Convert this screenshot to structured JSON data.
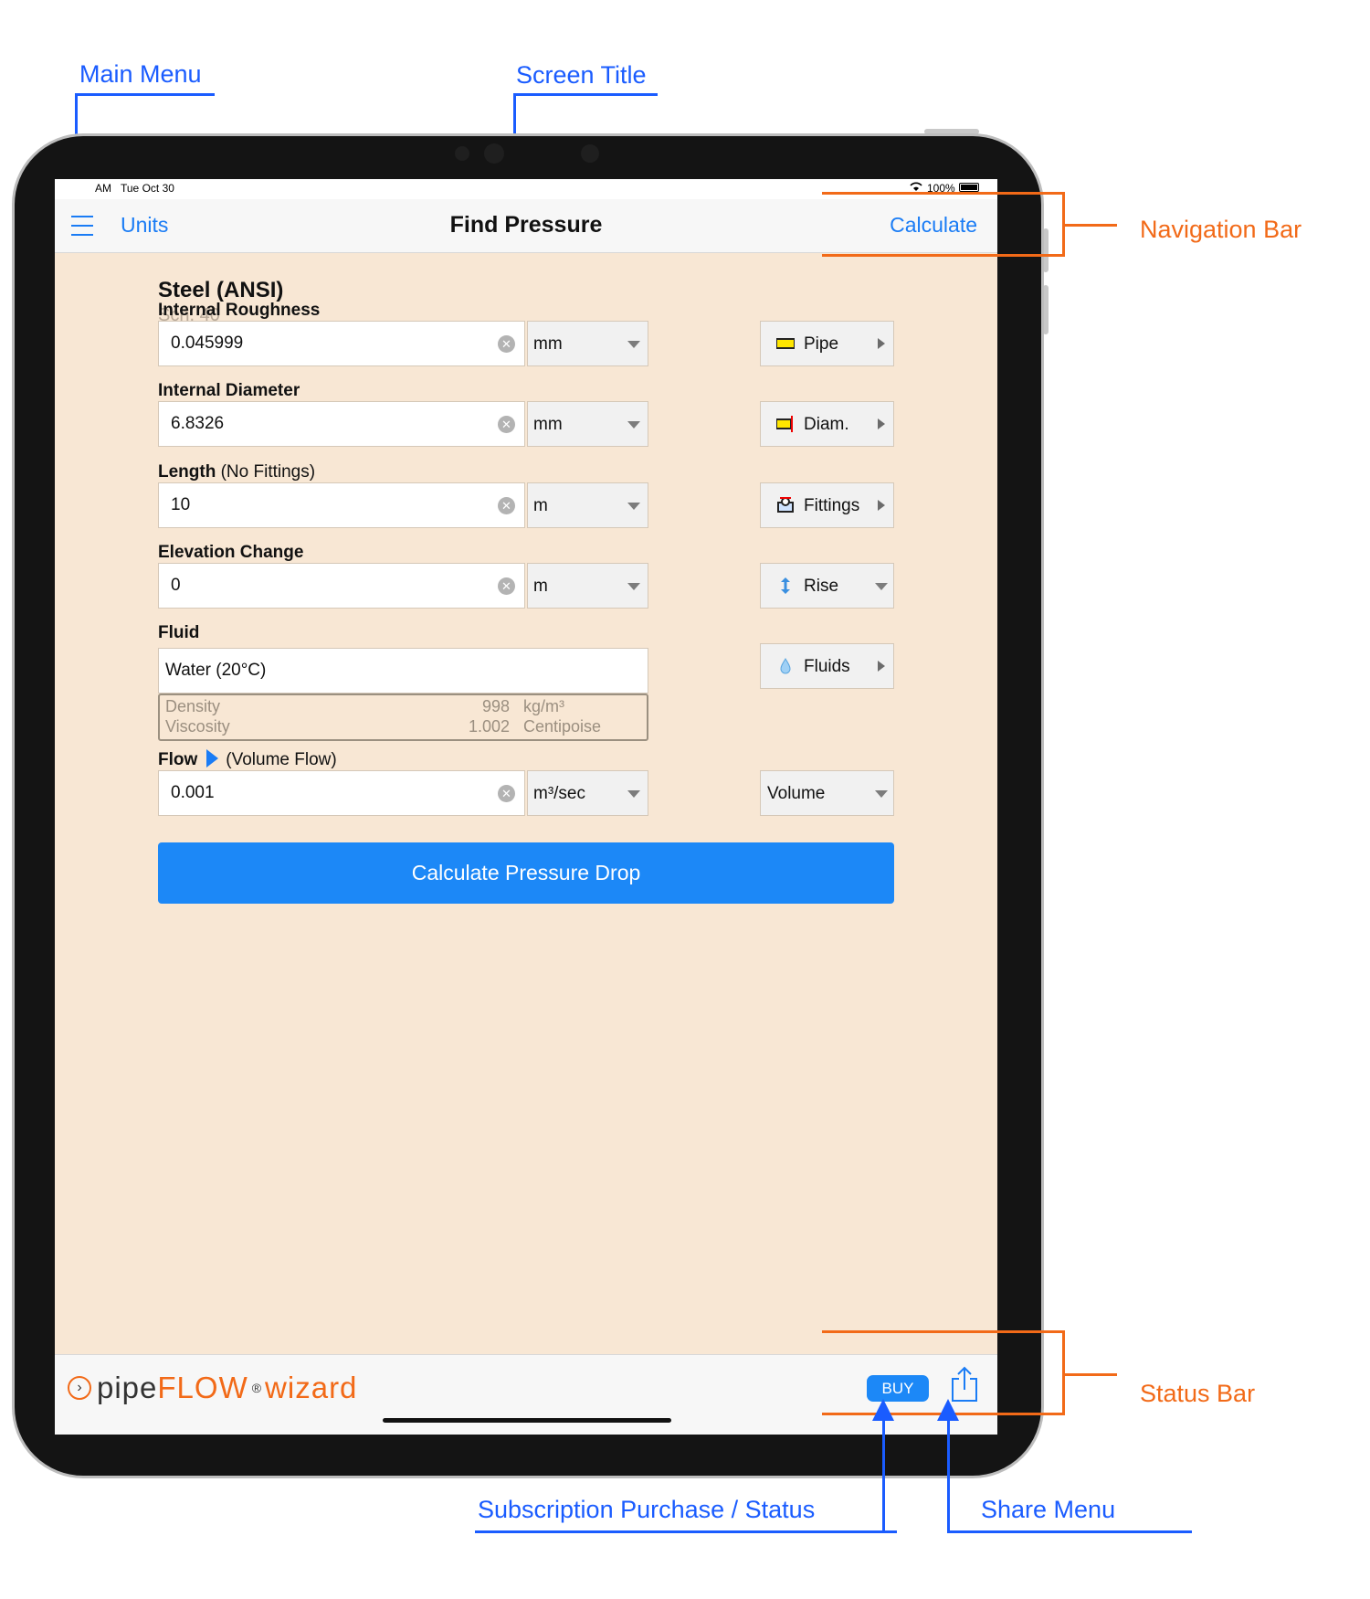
{
  "annotations": {
    "main_menu": "Main Menu",
    "screen_title": "Screen Title",
    "navigation_bar": "Navigation Bar",
    "status_bar": "Status Bar",
    "subscription": "Subscription Purchase / Status",
    "share_menu": "Share Menu"
  },
  "status": {
    "time": "AM",
    "date": "Tue Oct 30",
    "battery": "100%"
  },
  "nav": {
    "units": "Units",
    "title": "Find Pressure",
    "calculate": "Calculate"
  },
  "pipe": {
    "material": "Steel (ANSI)",
    "schedule": "Sch.  40"
  },
  "fields": [
    {
      "label": "Internal Roughness",
      "sublabel": "",
      "value": "0.045999",
      "unit": "mm",
      "button": "Pipe"
    },
    {
      "label": "Internal Diameter",
      "sublabel": "",
      "value": "6.8326",
      "unit": "mm",
      "button": "Diam."
    },
    {
      "label": "Length",
      "sublabel": "(No Fittings)",
      "value": "10",
      "unit": "m",
      "button": "Fittings"
    },
    {
      "label": "Elevation Change",
      "sublabel": "",
      "value": "0",
      "unit": "m",
      "button": "Rise"
    }
  ],
  "fluid": {
    "label": "Fluid",
    "value": "Water (20°C)",
    "button": "Fluids",
    "density_label": "Density",
    "density_value": "998",
    "density_unit": "kg/m³",
    "viscosity_label": "Viscosity",
    "viscosity_value": "1.002",
    "viscosity_unit": "Centipoise"
  },
  "flow": {
    "label": "Flow",
    "sublabel": "(Volume Flow)",
    "value": "0.001",
    "unit": "m³/sec",
    "type": "Volume"
  },
  "action": {
    "calculate": "Calculate Pressure Drop"
  },
  "footer": {
    "logo_part1": "pipe",
    "logo_part2": "FLOW",
    "logo_reg": "®",
    "logo_part3": "wizard",
    "buy": "BUY"
  },
  "colors": {
    "accent": "#1c88f7",
    "annotation_blue": "#1a5cff",
    "annotation_orange": "#f26a18",
    "background": "#f8e7d4"
  }
}
